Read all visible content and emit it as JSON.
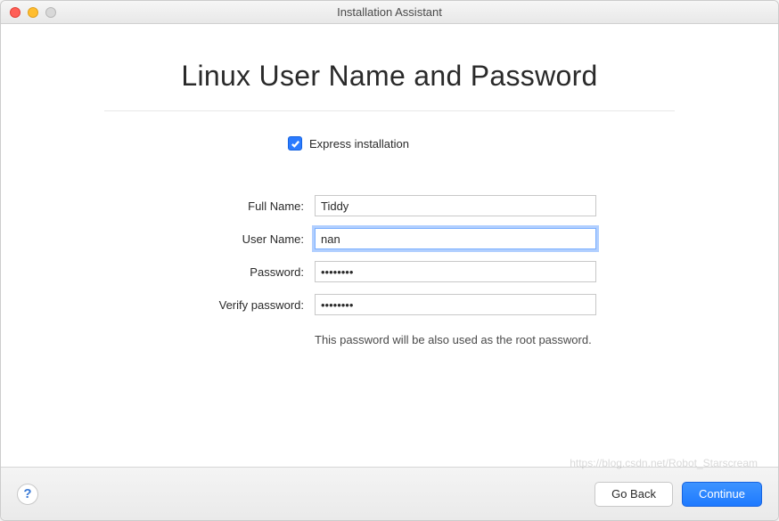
{
  "window": {
    "title": "Installation Assistant"
  },
  "page": {
    "heading": "Linux User Name and Password",
    "express_label": "Express installation",
    "express_checked": true,
    "hint": "This password will be also used as the root password."
  },
  "form": {
    "full_name": {
      "label": "Full Name:",
      "value": "Tiddy"
    },
    "user_name": {
      "label": "User Name:",
      "value": "nan"
    },
    "password": {
      "label": "Password:",
      "value": "••••••••"
    },
    "verify": {
      "label": "Verify password:",
      "value": "••••••••"
    }
  },
  "footer": {
    "help": "?",
    "go_back": "Go Back",
    "continue": "Continue"
  },
  "watermark": "https://blog.csdn.net/Robot_Starscream"
}
